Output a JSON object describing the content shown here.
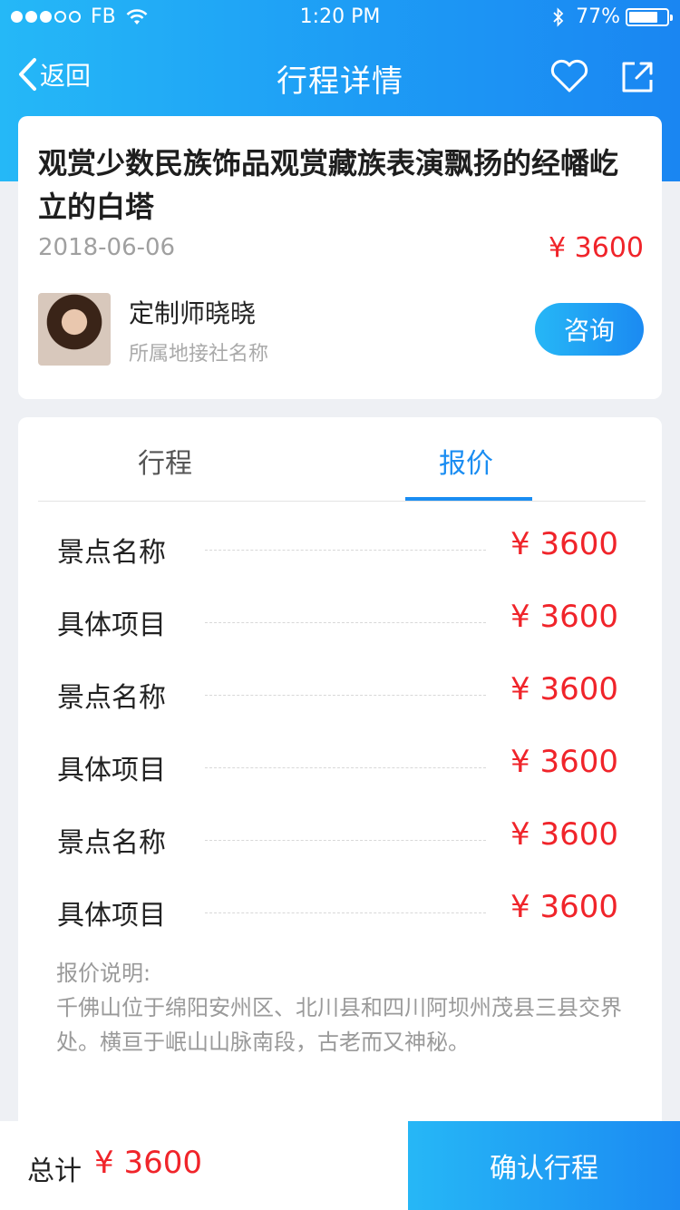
{
  "statusbar": {
    "carrier": "FB",
    "time": "1:20 PM",
    "battery_pct": "77%",
    "battery_level": 0.77
  },
  "navbar": {
    "back_label": "返回",
    "title": "行程详情"
  },
  "tour": {
    "title": "观赏少数民族饰品观赏藏族表演飘扬的经幡屹立的白塔",
    "date": "2018-06-06",
    "price": "¥ 3600"
  },
  "customizer": {
    "name": "定制师晓晓",
    "agency": "所属地接社名称",
    "consult_label": "咨询"
  },
  "tabs": [
    {
      "label": "行程",
      "active": false
    },
    {
      "label": "报价",
      "active": true
    }
  ],
  "quote_rows": [
    {
      "label": "景点名称",
      "price": "¥ 3600"
    },
    {
      "label": "具体项目",
      "price": "¥ 3600"
    },
    {
      "label": "景点名称",
      "price": "¥ 3600"
    },
    {
      "label": "具体项目",
      "price": "¥ 3600"
    },
    {
      "label": "景点名称",
      "price": "¥ 3600"
    },
    {
      "label": "具体项目",
      "price": "¥ 3600"
    }
  ],
  "quote_note": {
    "title": "报价说明:",
    "text": "千佛山位于绵阳安州区、北川县和四川阿坝州茂县三县交界处。横亘于岷山山脉南段，古老而又神秘。"
  },
  "footer": {
    "total_label": "总计",
    "total_value": "¥ 3600",
    "confirm_label": "确认行程"
  },
  "colors": {
    "accent": "#1a8df2",
    "price": "#f0242a",
    "gradient_start": "#26b7f6",
    "gradient_end": "#1b8af2"
  }
}
